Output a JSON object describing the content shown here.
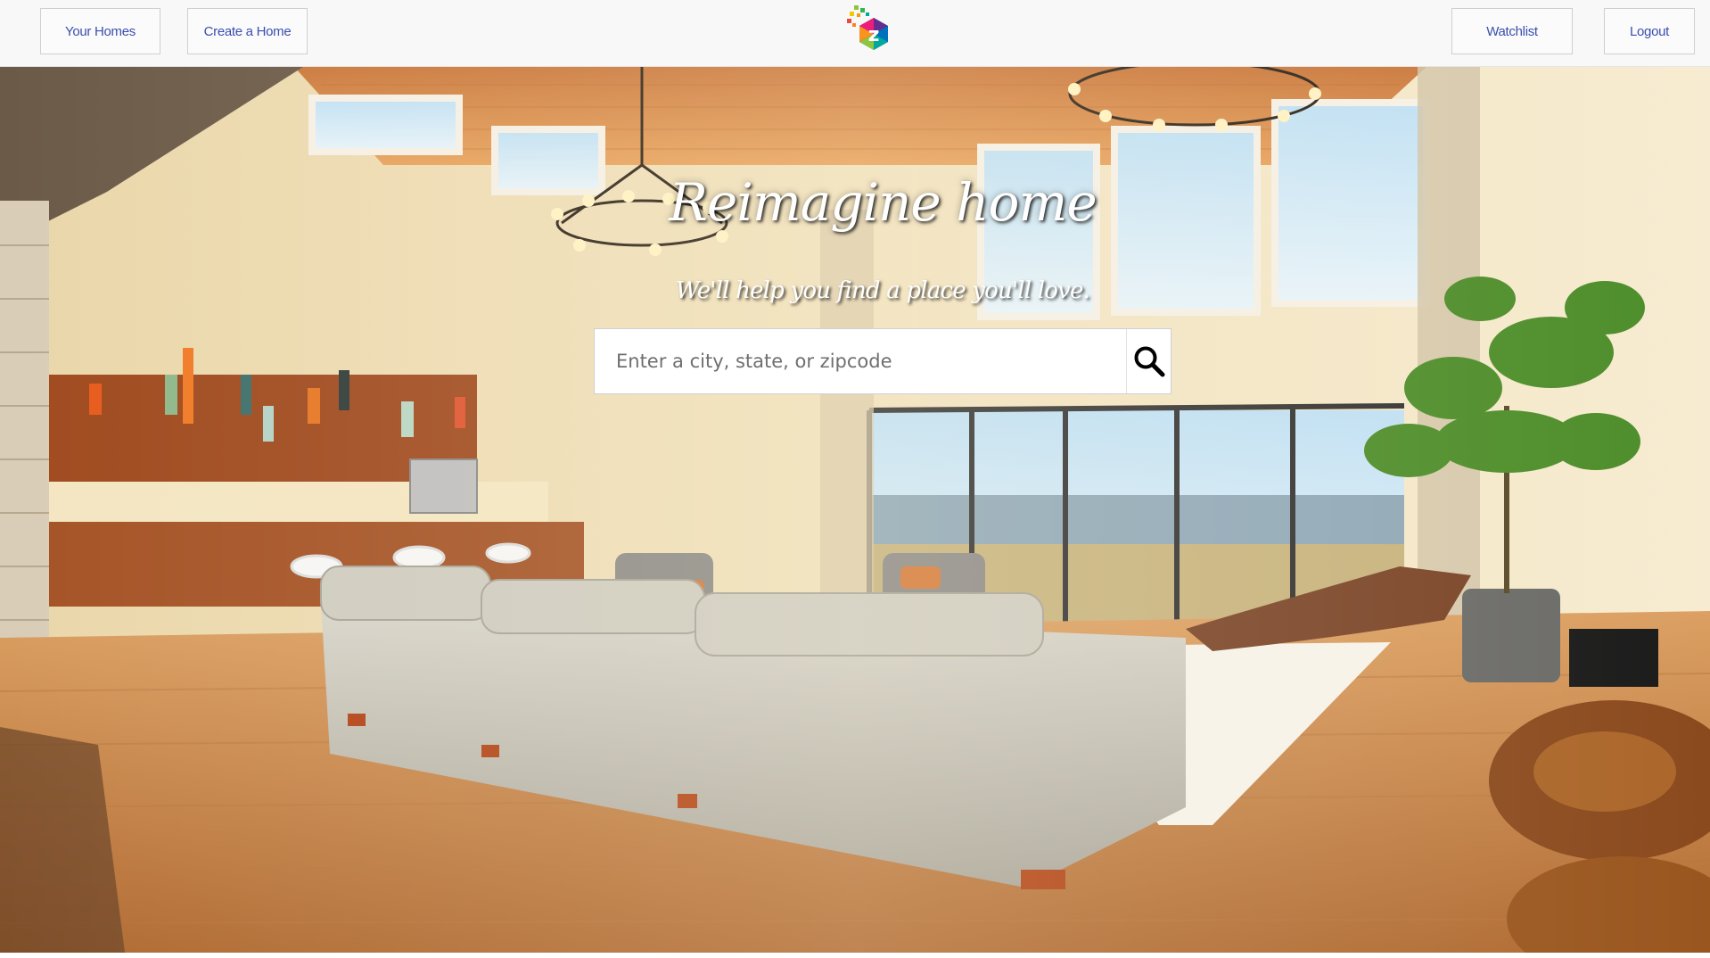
{
  "header": {
    "nav_left": [
      {
        "label": "Your Homes"
      },
      {
        "label": "Create a Home"
      }
    ],
    "nav_right": [
      {
        "label": "Watchlist"
      },
      {
        "label": "Logout"
      }
    ],
    "logo": {
      "icon": "colorful-z-logo-icon",
      "letter": "z"
    }
  },
  "hero": {
    "title": "Reimagine home",
    "subtitle": "We'll help you find a place you'll love.",
    "search": {
      "placeholder": "Enter a city, state, or zipcode",
      "value": "",
      "button_icon": "search-icon"
    },
    "background": "living-room-photo"
  },
  "colors": {
    "nav_text": "#3a4fb0",
    "header_bg": "#f8f8f8"
  }
}
